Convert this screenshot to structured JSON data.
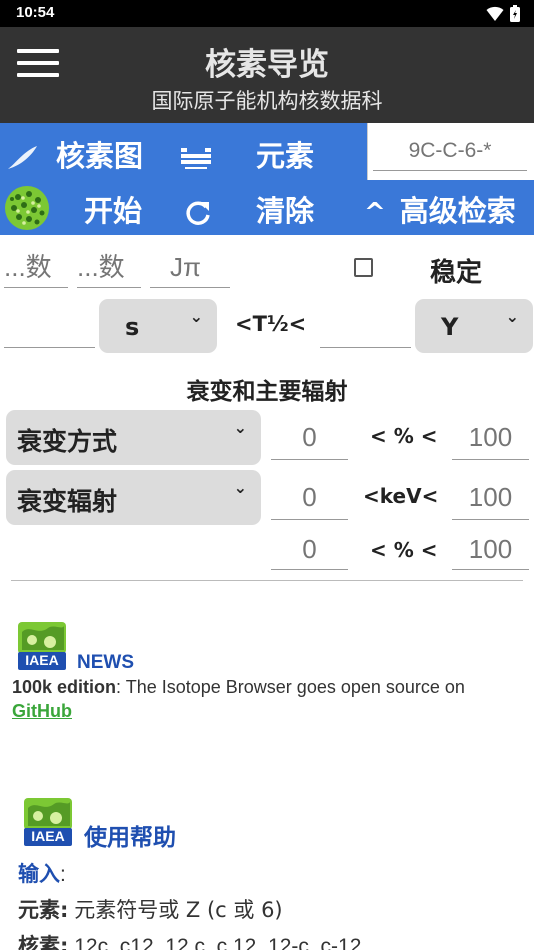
{
  "status": {
    "time": "10:54"
  },
  "appbar": {
    "title": "核素导览",
    "subtitle": "国际原子能机构核数据科"
  },
  "toolbar": {
    "chart_label": "核素图",
    "element_label": "元素",
    "search_placeholder": "9C-C-6-*",
    "start_label": "开始",
    "clear_label": "清除",
    "advanced_label": "高级检索",
    "advanced_caret": "^"
  },
  "filters": {
    "z_placeholder": "...数",
    "n_placeholder": "...数",
    "jpi_placeholder": "Jπ",
    "stable_label": "稳定",
    "halflife_unit": "s",
    "halflife_op": "<T½<",
    "halflife_unit2": "Y",
    "decay_header": "衰变和主要辐射",
    "decay_mode_label": "衰变方式",
    "decay_mode_min": "0",
    "decay_mode_op": "< % <",
    "decay_mode_max": "100",
    "radiation_label": "衰变辐射",
    "radiation_min": "0",
    "radiation_op": "<keV<",
    "radiation_max": "100",
    "intensity_min": "0",
    "intensity_op": "< % <",
    "intensity_max": "100"
  },
  "news": {
    "logo_text": "IAEA",
    "title": "NEWS",
    "edition": "100k edition",
    "text": ": The Isotope Browser goes open source on",
    "link": "GitHub"
  },
  "help": {
    "logo_text": "IAEA",
    "title": "使用帮助",
    "input_label": "输入",
    "input_colon": ":",
    "element_label": "元素",
    "element_text": "元素符号或 Z (c 或 6)",
    "nuclide_label": "核素",
    "nuclide_text": "12c, c12, 12 c, c 12, 12-c, c-12"
  }
}
